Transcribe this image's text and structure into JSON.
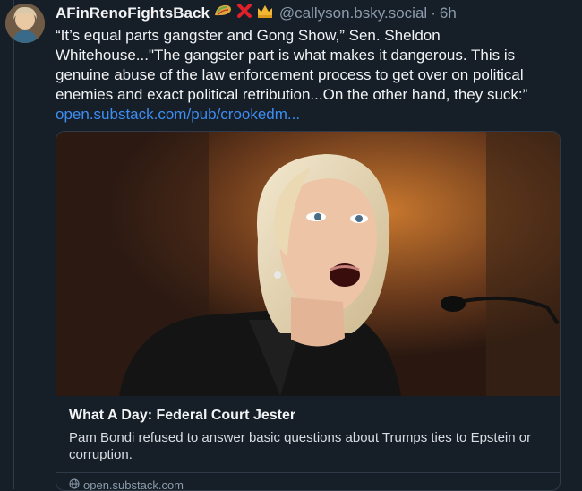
{
  "post": {
    "author": "AFinRenoFightsBack",
    "emoji_names": [
      "taco-emoji",
      "cross-mark-emoji",
      "crown-emoji"
    ],
    "handle": "@callyson.bsky.social",
    "separator": "·",
    "time": "6h",
    "text": "“It’s equal parts gangster and Gong Show,” Sen. Sheldon Whitehouse...\"The gangster part is what makes it dangerous. This is genuine abuse of the law enforcement process to get over on political enemies and exact political retribution...On the other hand, they suck:”",
    "link": "open.substack.com/pub/crookedm..."
  },
  "card": {
    "title": "What A Day: Federal Court Jester",
    "description": "Pam Bondi refused to answer basic questions about Trumps ties to Epstein or corruption.",
    "domain": "open.substack.com"
  },
  "colors": {
    "background": "#161e27",
    "link": "#3d8df2",
    "muted": "#8c9bab",
    "border": "#2e3a47"
  }
}
